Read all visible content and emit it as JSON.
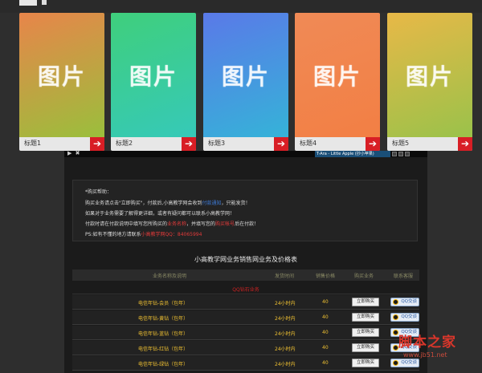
{
  "cards": [
    {
      "label": "标题1",
      "placeholder": "图片",
      "gradient": [
        "#e8854a",
        "#9abf3c"
      ]
    },
    {
      "label": "标题2",
      "placeholder": "图片",
      "gradient": [
        "#3fcf7c",
        "#36c9b8"
      ]
    },
    {
      "label": "标题3",
      "placeholder": "图片",
      "gradient": [
        "#5a79e8",
        "#35b3d8"
      ]
    },
    {
      "label": "标题4",
      "placeholder": "图片",
      "gradient": [
        "#f08a56",
        "#f27f44"
      ]
    },
    {
      "label": "标题5",
      "placeholder": "图片",
      "gradient": [
        "#e8b847",
        "#9ac24a"
      ]
    }
  ],
  "arrow_glyph": "➔",
  "music": {
    "icons": "▶ ✖",
    "track": "T-Ara - Little Apple (抄小苹果)"
  },
  "notice": {
    "lines": [
      {
        "parts": [
          {
            "t": "*购买帮助："
          }
        ]
      },
      {
        "parts": [
          {
            "t": "购买业务请点击\"立即购买\"，付款后,小高教学网会收到"
          },
          {
            "t": "付款通知",
            "c": "blue"
          },
          {
            "t": "，只能发货！"
          }
        ]
      },
      {
        "parts": [
          {
            "t": "如果对于业务需要了解得更详细，或者有疑问都可以联系小高教学网！"
          }
        ]
      },
      {
        "parts": [
          {
            "t": "付款时请在付款说明中填写您所购买的"
          },
          {
            "t": "业务名称",
            "c": "red"
          },
          {
            "t": "，并填写您的"
          },
          {
            "t": "购买帐号",
            "c": "red"
          },
          {
            "t": "后在付款！"
          }
        ]
      },
      {
        "parts": [
          {
            "t": "PS:如有不懂的地方请联系"
          },
          {
            "t": "小高教学网QQ：84065994",
            "c": "red"
          }
        ]
      }
    ]
  },
  "table": {
    "title": "小高教学网业务销售网业务及价格表",
    "headers": [
      "业务名称及说明",
      "发货时间",
      "销售价格",
      "购买业务",
      "联系客服"
    ],
    "section": "QQ钻石业务",
    "buy_label": "立即购买",
    "qq_label": "QQ交谈",
    "rows": [
      {
        "name": "电信年钻-会员（包年）",
        "time": "24小时内",
        "price": "40"
      },
      {
        "name": "电信年钻-黄钻（包年）",
        "time": "24小时内",
        "price": "40"
      },
      {
        "name": "电信年钻-蓝钻（包年）",
        "time": "24小时内",
        "price": "40"
      },
      {
        "name": "电信年钻-红钻（包年）",
        "time": "24小时内",
        "price": "40"
      },
      {
        "name": "电信年钻-绿钻（包年）",
        "time": "24小时内",
        "price": "40"
      }
    ]
  },
  "watermark": {
    "main": "脚本之家",
    "sub": "www.jb51.net"
  }
}
